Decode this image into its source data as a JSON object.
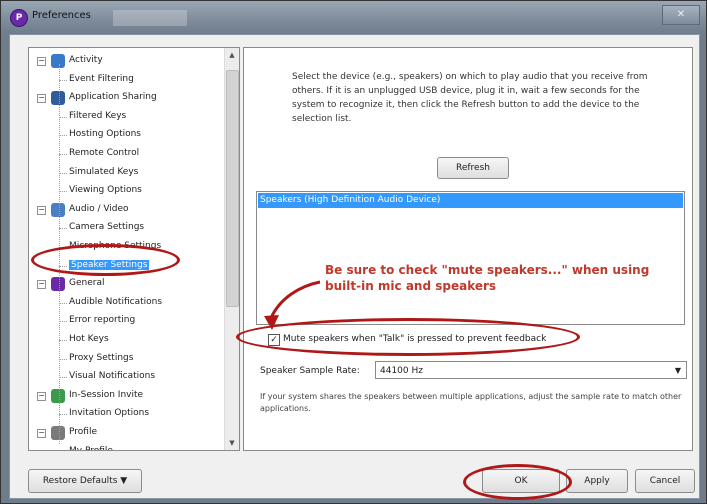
{
  "window": {
    "title": "Preferences",
    "close_glyph": "✕"
  },
  "tree": {
    "items": [
      {
        "label": "Activity",
        "icon": "activity-icon",
        "color": "#3a78c9",
        "expander": "−"
      },
      {
        "label": "Event Filtering"
      },
      {
        "label": "Application Sharing",
        "icon": "monitor-icon",
        "color": "#2f5d9a",
        "expander": "−"
      },
      {
        "label": "Filtered Keys"
      },
      {
        "label": "Hosting Options"
      },
      {
        "label": "Remote Control"
      },
      {
        "label": "Simulated Keys"
      },
      {
        "label": "Viewing Options"
      },
      {
        "label": "Audio / Video",
        "icon": "person-icon",
        "color": "#4a7fc4",
        "expander": "−"
      },
      {
        "label": "Camera Settings"
      },
      {
        "label": "Microphone Settings"
      },
      {
        "label": "Speaker Settings",
        "selected": true
      },
      {
        "label": "General",
        "icon": "app-logo-icon",
        "color": "#6a2aa8",
        "expander": "−"
      },
      {
        "label": "Audible Notifications"
      },
      {
        "label": "Error reporting"
      },
      {
        "label": "Hot Keys"
      },
      {
        "label": "Proxy Settings"
      },
      {
        "label": "Visual Notifications"
      },
      {
        "label": "In-Session Invite",
        "icon": "invite-icon",
        "color": "#3a9a4a",
        "expander": "−"
      },
      {
        "label": "Invitation Options"
      },
      {
        "label": "Profile",
        "icon": "profile-icon",
        "color": "#7a7a7a",
        "expander": "−"
      },
      {
        "label": "My Profile"
      }
    ]
  },
  "panel": {
    "description": "Select the device (e.g., speakers) on which to play audio that you receive from others. If it is an unplugged USB device, plug it in, wait a few seconds for the system to recognize it, then click the Refresh button to add the device to the selection list.",
    "refresh_label": "Refresh",
    "devices": [
      "Speakers (High Definition Audio Device)"
    ],
    "callout": "Be sure to check \"mute speakers...\" when using built-in mic and speakers",
    "mute_label": "Mute speakers when \"Talk\" is pressed to prevent feedback",
    "mute_checked": "✓",
    "sample_rate_label": "Speaker Sample Rate:",
    "sample_rate_value": "44100 Hz",
    "note": "If your system shares the speakers between multiple applications, adjust the sample rate to match other applications."
  },
  "buttons": {
    "restore_defaults": "Restore Defaults ▼",
    "ok": "OK",
    "apply": "Apply",
    "cancel": "Cancel"
  },
  "colors": {
    "selection": "#3399ff",
    "annotation": "#b01818",
    "callout": "#c0392b"
  }
}
